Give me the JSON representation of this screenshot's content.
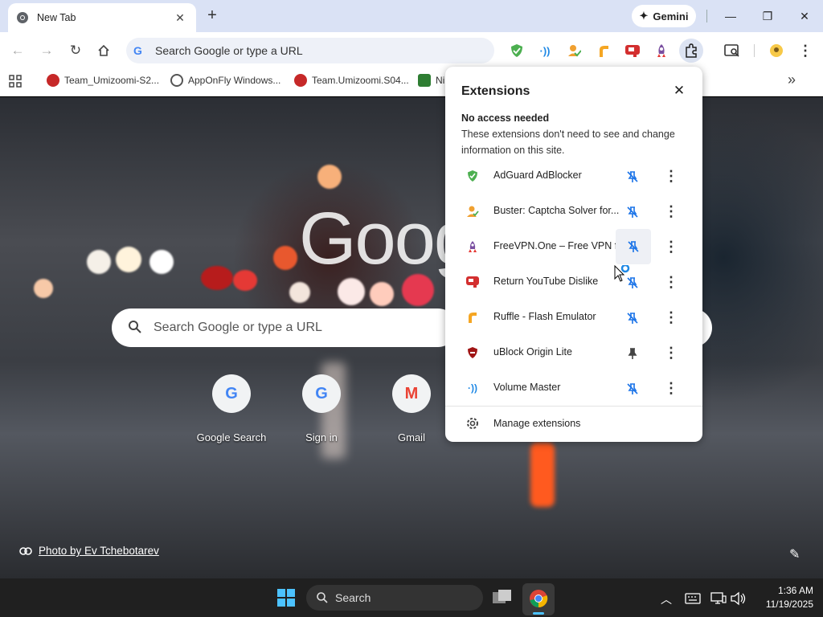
{
  "browser": {
    "tab_title": "New Tab",
    "tab_close": "✕",
    "new_tab": "+",
    "gemini_label": "Gemini",
    "omnibox_placeholder": "Search Google or type a URL"
  },
  "window_controls": {
    "minimize": "—",
    "maximize": "❐",
    "close": "✕"
  },
  "toolbar_icons": [
    "back-icon",
    "forward-icon",
    "reload-icon",
    "home-icon",
    "adguard-icon",
    "volume-master-icon",
    "buster-icon",
    "ruffle-icon",
    "return-youtube-dislike-icon",
    "freevpn-icon",
    "extensions-puzzle-icon",
    "tab-search-icon",
    "profile-icon",
    "menu-icon"
  ],
  "bookmarks": [
    {
      "label": "Team_Umizoomi-S2...",
      "icon_color": "#c62828"
    },
    {
      "label": "AppOnFly Windows...",
      "icon_color": "#555555"
    },
    {
      "label": "Team.Umizoomi.S04...",
      "icon_color": "#c62828"
    },
    {
      "label": "Ni",
      "icon_color": "#2e7d32"
    }
  ],
  "bookmarks_more": "»",
  "ntp": {
    "logo_text": "Goog",
    "search_placeholder": "Search Google or type a URL",
    "shortcuts": [
      {
        "label": "Google Search",
        "glyph": "G"
      },
      {
        "label": "Sign in",
        "glyph": "G"
      },
      {
        "label": "Gmail",
        "glyph": "M"
      }
    ],
    "photo_credit": "Photo by Ev Tchebotarev"
  },
  "extensions_popup": {
    "title": "Extensions",
    "close": "✕",
    "section_title": "No access needed",
    "section_desc": "These extensions don't need to see and change information on this site.",
    "items": [
      {
        "name": "AdGuard AdBlocker",
        "icon": "adguard-icon",
        "pinned": false,
        "color": "#4caf50"
      },
      {
        "name": "Buster: Captcha Solver for...",
        "icon": "buster-icon",
        "pinned": false,
        "color": "#f0a030"
      },
      {
        "name": "FreeVPN.One – Free VPN f...",
        "icon": "freevpn-icon",
        "pinned": false,
        "color": "#7a4fa0"
      },
      {
        "name": "Return YouTube Dislike",
        "icon": "return-youtube-dislike-icon",
        "pinned": false,
        "color": "#d32f2f"
      },
      {
        "name": "Ruffle - Flash Emulator",
        "icon": "ruffle-icon",
        "pinned": false,
        "color": "#f5a623"
      },
      {
        "name": "uBlock Origin Lite",
        "icon": "ublock-icon",
        "pinned": true,
        "color": "#a01515"
      },
      {
        "name": "Volume Master",
        "icon": "volume-master-icon",
        "pinned": false,
        "color": "#1e88e5"
      }
    ],
    "more": "⋮",
    "manage_label": "Manage extensions"
  },
  "taskbar": {
    "search_label": "Search",
    "time": "1:36 AM",
    "date": "11/19/2025"
  },
  "colors": {
    "accent_blue": "#1a73e8",
    "pin_blue": "#1a73e8",
    "tabstrip": "#dae2f5"
  }
}
